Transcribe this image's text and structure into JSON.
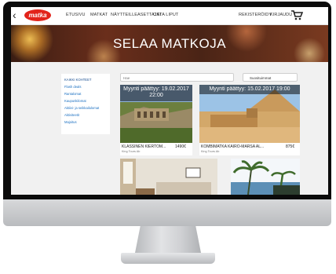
{
  "nav": {
    "back": "‹",
    "logo": "matka",
    "links": [
      "ETUSIVU",
      "MATKAT",
      "NÄYTTEILLEASETTAJAT",
      "OSTA LIPUT"
    ],
    "register": "REKISTERÖIDY",
    "login": "KIRJAUDU"
  },
  "hero": {
    "title": "SELAA MATKOJA"
  },
  "sidebar": {
    "categories": [
      "KAIKKI KOHTEET",
      "Flash deals",
      "Rantalomat",
      "Kaupunkilomat",
      "Aktiivi- ja seikkailulomat",
      "Aktiviteetit",
      "Majoitus"
    ]
  },
  "search": {
    "placeholder": "Hae"
  },
  "sort": {
    "label": "Suosituimmat"
  },
  "cards": [
    {
      "banner": "Myynti päättyy: 19.02.2017 22:00",
      "title": "KLASSINEN KIERTOM...",
      "operator": "King Tours Ab",
      "price": "1490€"
    },
    {
      "banner": "Myynti päättyy: 15.02.2017 19:00",
      "title": "KOMBIMATKA KAIRO-MARSA AL...",
      "operator": "King Tours Ab",
      "price": "875€"
    }
  ],
  "colors": {
    "brand": "#e2231a",
    "link": "#1a6fc1"
  }
}
